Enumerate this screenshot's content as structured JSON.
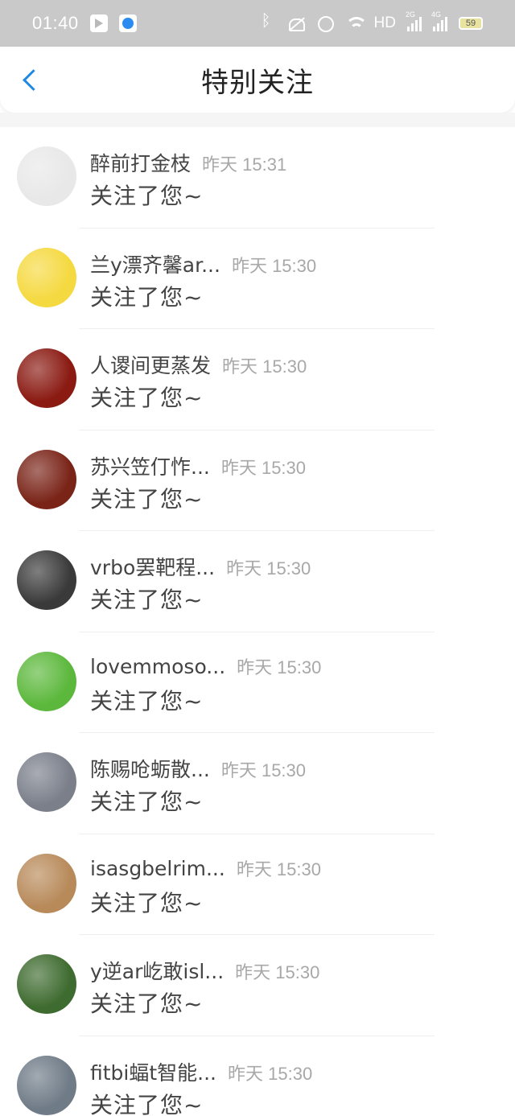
{
  "status_bar": {
    "time": "01:40",
    "hd_label": "HD",
    "signal_2g": "2G",
    "signal_4g": "4G",
    "battery": "59"
  },
  "header": {
    "title": "特别关注"
  },
  "notifications": [
    {
      "name": "醉前打金枝",
      "time": "昨天 15:31",
      "action": "关注了您~",
      "avatar_color": "#e8e8e8"
    },
    {
      "name": "兰y漂齐馨ar...",
      "time": "昨天 15:30",
      "action": "关注了您~",
      "avatar_color": "#f5d940"
    },
    {
      "name": "人谡间更蒸发",
      "time": "昨天 15:30",
      "action": "关注了您~",
      "avatar_color": "#8a1a12"
    },
    {
      "name": "苏兴笠仃怍...",
      "time": "昨天 15:30",
      "action": "关注了您~",
      "avatar_color": "#7a2418"
    },
    {
      "name": "vrbo罢靶程...",
      "time": "昨天 15:30",
      "action": "关注了您~",
      "avatar_color": "#3a3a3a"
    },
    {
      "name": "lovemmoso...",
      "time": "昨天 15:30",
      "action": "关注了您~",
      "avatar_color": "#5cb83c"
    },
    {
      "name": "陈赐呛蛎散...",
      "time": "昨天 15:30",
      "action": "关注了您~",
      "avatar_color": "#7a7f8a"
    },
    {
      "name": "isasgbelrim...",
      "time": "昨天 15:30",
      "action": "关注了您~",
      "avatar_color": "#b88a5a"
    },
    {
      "name": "y逆ar屹敢isl...",
      "time": "昨天 15:30",
      "action": "关注了您~",
      "avatar_color": "#3e6b2f"
    },
    {
      "name": "fitbi蝠t智能...",
      "time": "昨天 15:30",
      "action": "关注了您~",
      "avatar_color": "#6f7b87"
    }
  ]
}
